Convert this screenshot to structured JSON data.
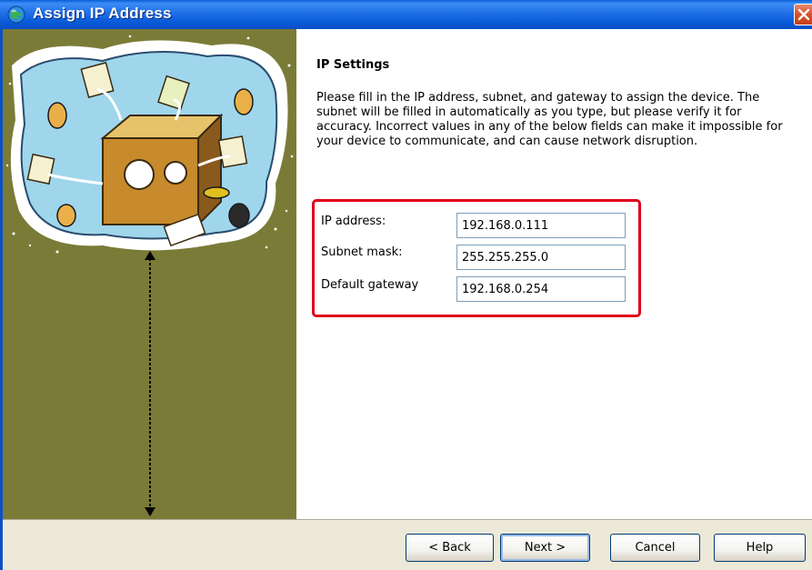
{
  "window": {
    "title": "Assign IP Address"
  },
  "page": {
    "heading": "IP Settings",
    "description": "Please fill in the IP address, subnet, and gateway to assign the device. The subnet will be filled in automatically as you type, but please verify it for accuracy.  Incorrect values in any of the below fields can make it impossible for your device to communicate, and can cause network disruption."
  },
  "fields": {
    "ip": {
      "label": "IP address:",
      "value": "192.168.0.111"
    },
    "subnet": {
      "label": "Subnet mask:",
      "value": "255.255.255.0"
    },
    "gateway": {
      "label": "Default gateway",
      "value": "192.168.0.254"
    }
  },
  "buttons": {
    "back": "< Back",
    "next": "Next >",
    "cancel": "Cancel",
    "help": "Help"
  },
  "colors": {
    "titlebar": "#0858d6",
    "side_panel": "#7b7b38",
    "highlight_border": "#e0001b",
    "dialog_bg": "#ece9d8"
  },
  "icons": [
    "app-globe-icon",
    "close-icon",
    "network-illustration",
    "vertical-arrow"
  ]
}
